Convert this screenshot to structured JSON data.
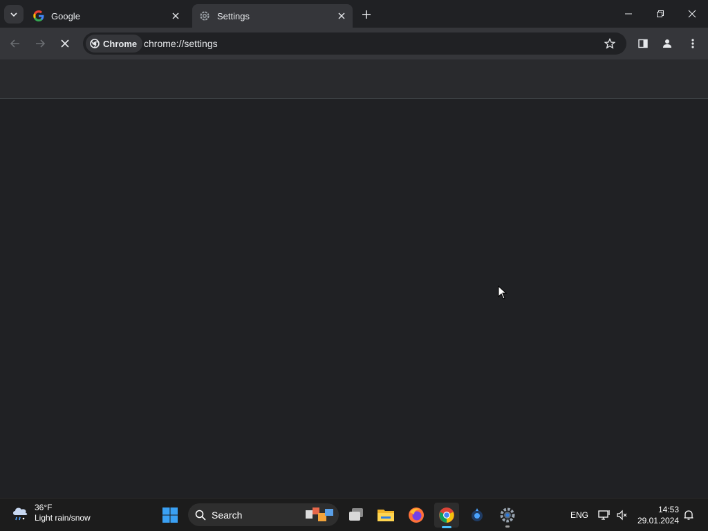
{
  "tabs": [
    {
      "title": "Google",
      "favicon": "google-g-icon",
      "active": false
    },
    {
      "title": "Settings",
      "favicon": "settings-gear-icon",
      "active": true
    }
  ],
  "omnibox": {
    "chip_label": "Chrome",
    "url": "chrome://settings"
  },
  "page_state": {
    "loading": true
  },
  "taskbar": {
    "weather": {
      "temp": "36°F",
      "condition": "Light rain/snow",
      "icon": "rain-snow-cloud-icon"
    },
    "search": {
      "placeholder": "Search"
    },
    "apps": [
      "start",
      "search",
      "task-view",
      "file-explorer",
      "firefox",
      "chrome",
      "generic-app",
      "settings"
    ],
    "language": "ENG",
    "time": "14:53",
    "date": "29.01.2024"
  },
  "colors": {
    "chrome_dark_bg": "#202124",
    "toolbar": "#35363a",
    "taskbar": "#1c1c1c",
    "accent": "#4cc2ff"
  }
}
